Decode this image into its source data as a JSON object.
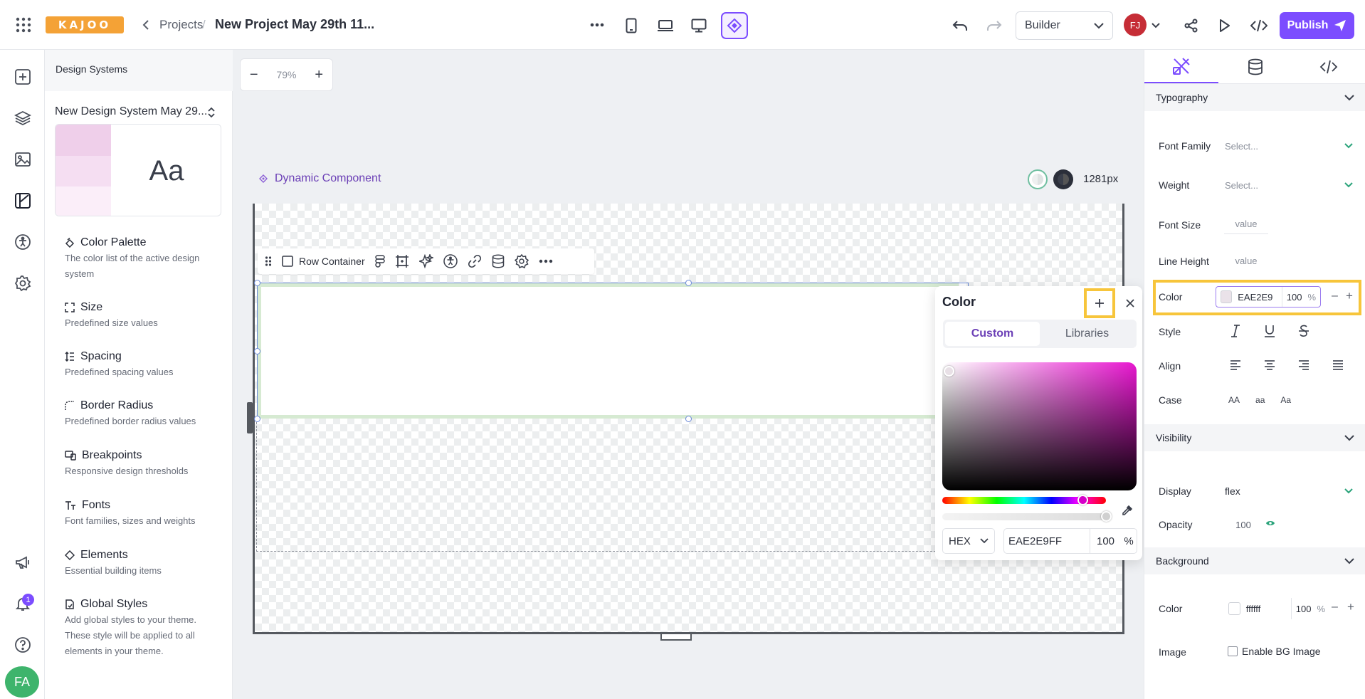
{
  "topbar": {
    "logo_text": "KAJOO",
    "crumb_projects": "Projects",
    "crumb_sep": "/",
    "project_title": "New Project May 29th 11...",
    "mode_select": "Builder",
    "user_initials": "FJ",
    "publish_label": "Publish"
  },
  "left_rail": {
    "icons": [
      "add-icon",
      "layers-icon",
      "image-icon",
      "design-system-icon",
      "accessibility-icon",
      "settings-icon",
      "megaphone-icon",
      "bell-icon",
      "help-icon"
    ],
    "notification_count": "1",
    "user_initials": "FA"
  },
  "design_systems": {
    "header": "Design Systems",
    "system_name": "New Design System May 29...",
    "preview_text": "Aa",
    "items": [
      {
        "title": "Color Palette",
        "desc": "The color list of the active design system",
        "icon": "palette-icon"
      },
      {
        "title": "Size",
        "desc": "Predefined size values",
        "icon": "size-icon"
      },
      {
        "title": "Spacing",
        "desc": "Predefined spacing values",
        "icon": "spacing-icon"
      },
      {
        "title": "Border Radius",
        "desc": "Predefined border radius values",
        "icon": "border-radius-icon"
      },
      {
        "title": "Breakpoints",
        "desc": "Responsive design thresholds",
        "icon": "breakpoints-icon"
      },
      {
        "title": "Fonts",
        "desc": "Font families, sizes and weights",
        "icon": "fonts-icon"
      },
      {
        "title": "Elements",
        "desc": "Essential building items",
        "icon": "elements-icon"
      },
      {
        "title": "Global Styles",
        "desc": "Add global styles to your theme. These style will be applied to all elements in your theme.",
        "icon": "global-styles-icon"
      }
    ]
  },
  "canvas": {
    "zoom_minus": "−",
    "zoom_value": "79%",
    "zoom_plus": "+",
    "component_label": "Dynamic Component",
    "width_label": "1281px",
    "toolbar_label": "Row Container"
  },
  "color_popup": {
    "title": "Color",
    "tabs": [
      "Custom",
      "Libraries"
    ],
    "active_tab": "Custom",
    "format": "HEX",
    "hex_value": "EAE2E9FF",
    "alpha": "100",
    "percent": "%",
    "saturation_color": "#e817d0"
  },
  "right_panel": {
    "sections": {
      "typography": "Typography",
      "visibility": "Visibility",
      "background": "Background"
    },
    "typography": {
      "font_family_label": "Font Family",
      "font_family_value": "Select...",
      "weight_label": "Weight",
      "weight_value": "Select...",
      "font_size_label": "Font Size",
      "font_size_placeholder": "value",
      "line_height_label": "Line Height",
      "line_height_placeholder": "value",
      "color_label": "Color",
      "color_value": "EAE2E9",
      "color_alpha": "100",
      "percent": "%",
      "style_label": "Style",
      "align_label": "Align",
      "case_label": "Case",
      "case_options": [
        "AA",
        "aa",
        "Aa"
      ]
    },
    "visibility": {
      "display_label": "Display",
      "display_value": "flex",
      "opacity_label": "Opacity",
      "opacity_value": "100"
    },
    "background": {
      "color_label": "Color",
      "color_value": "ffffff",
      "color_alpha": "100",
      "percent": "%",
      "image_label": "Image",
      "enable_bg_label": "Enable BG Image"
    }
  },
  "colors": {
    "accent": "#7c4dff",
    "highlight": "#f7c53b",
    "swatch_text": "#eae2e9"
  }
}
